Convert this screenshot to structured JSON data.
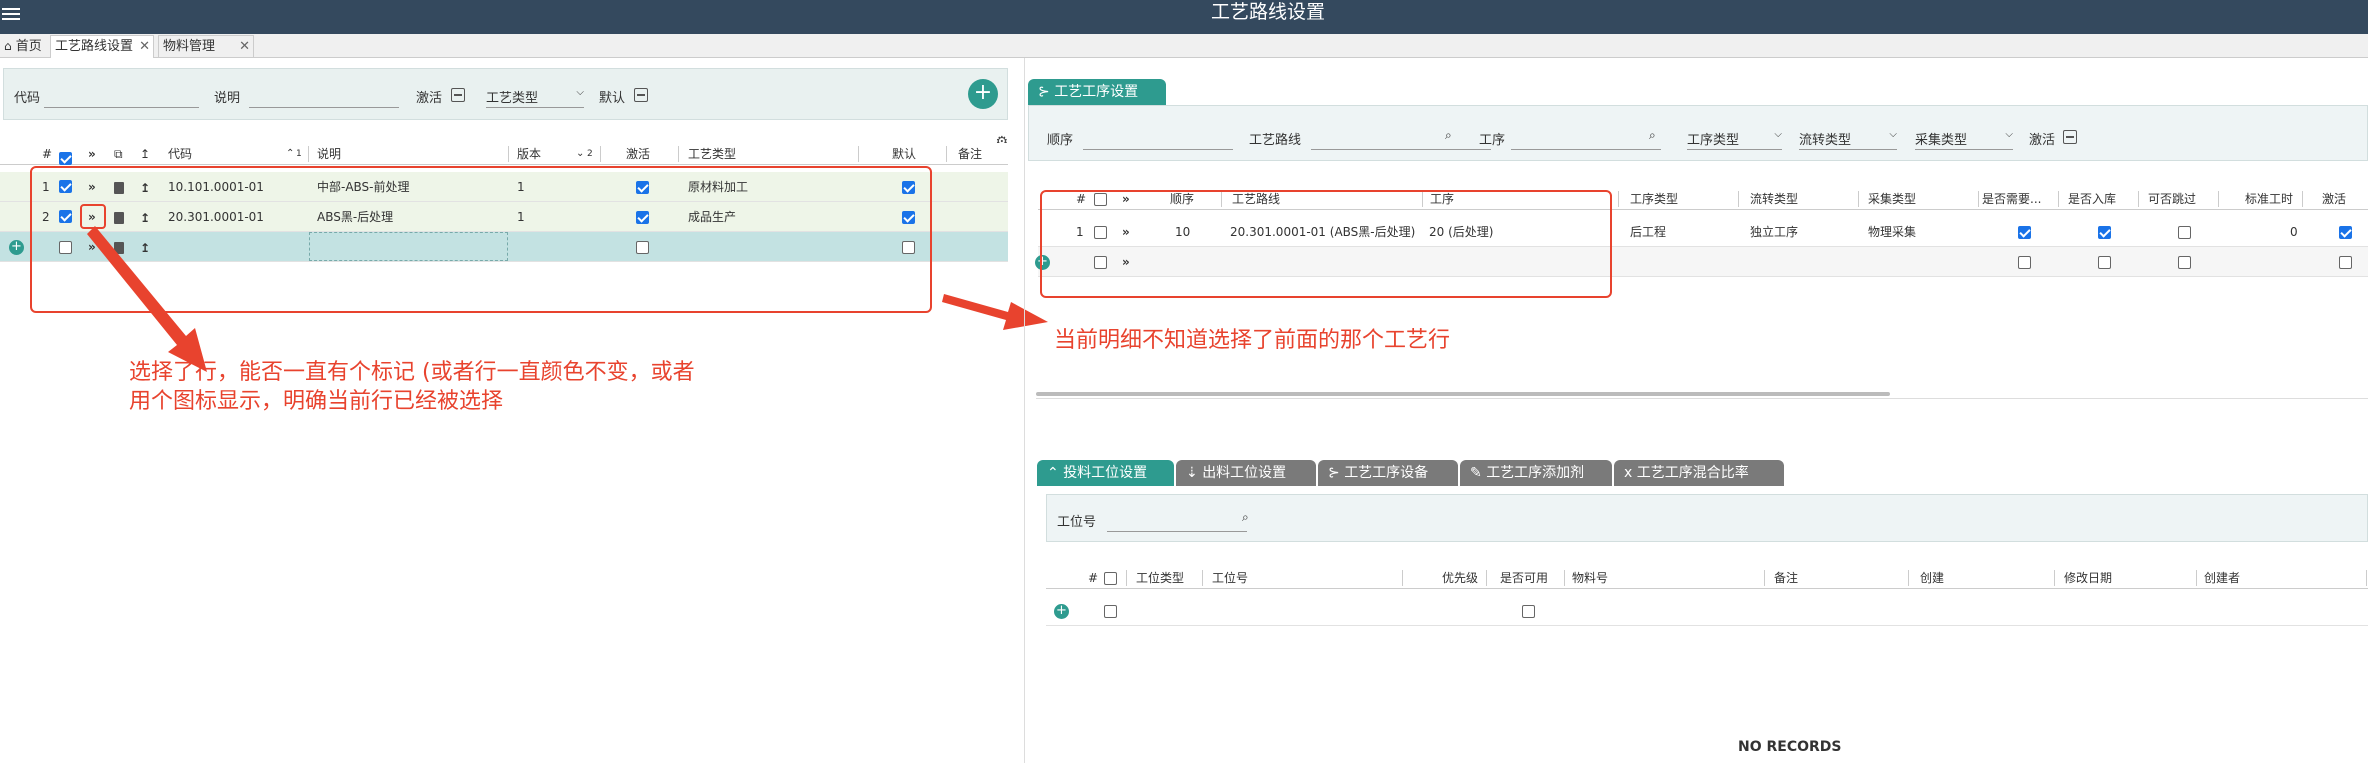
{
  "app": {
    "title": "工艺路线设置"
  },
  "tabs": [
    {
      "label": "首页"
    },
    {
      "label": "工艺路线设置"
    },
    {
      "label": "物料管理"
    }
  ],
  "left_filter": {
    "code_label": "代码",
    "desc_label": "说明",
    "active_label": "激活",
    "type_label": "工艺类型",
    "default_label": "默认"
  },
  "left_grid": {
    "headers": {
      "hash": "#",
      "code": "代码",
      "code_sort": "1",
      "desc": "说明",
      "version": "版本",
      "version_sort": "2",
      "active": "激活",
      "type": "工艺类型",
      "default": "默认",
      "remark": "备注"
    },
    "rows": [
      {
        "num": "1",
        "code": "10.101.0001-01",
        "desc": "中部-ABS-前处理",
        "version": "1",
        "type": "原材料加工"
      },
      {
        "num": "2",
        "code": "20.301.0001-01",
        "desc": "ABS黑-后处理",
        "version": "1",
        "type": "成品生产"
      }
    ]
  },
  "annotations": {
    "left_line1": "选择了行，能否一直有个标记 (或者行一直颜色不变，或者",
    "left_line2": "用个图标显示，明确当前行已经被选择",
    "right": "当前明细不知道选择了前面的那个工艺行"
  },
  "right_top": {
    "tab": "工艺工序设置",
    "filter": {
      "seq_label": "顺序",
      "route_label": "工艺路线",
      "proc_label": "工序",
      "proc_type": "工序类型",
      "flow_type": "流转类型",
      "collect_type": "采集类型",
      "active_label": "激活"
    },
    "headers": {
      "hash": "#",
      "seq": "顺序",
      "route": "工艺路线",
      "proc": "工序",
      "proc_type": "工序类型",
      "flow_type": "流转类型",
      "collect_type": "采集类型",
      "need": "是否需要...",
      "instock": "是否入库",
      "skip": "可否跳过",
      "std_time": "标准工时",
      "active": "激活"
    },
    "rows": [
      {
        "num": "1",
        "seq": "10",
        "route": "20.301.0001-01 (ABS黑-后处理)",
        "proc": "20 (后处理)",
        "proc_type": "后工程",
        "flow_type": "独立工序",
        "collect_type": "物理采集",
        "std_time": "0"
      }
    ]
  },
  "right_bottom": {
    "tabs": [
      "投料工位设置",
      "出料工位设置",
      "工艺工序设备",
      "工艺工序添加剂",
      "工艺工序混合比率"
    ],
    "filter": {
      "station_label": "工位号"
    },
    "headers": {
      "hash": "#",
      "station_type": "工位类型",
      "station_no": "工位号",
      "priority": "优先级",
      "available": "是否可用",
      "material": "物料号",
      "remark": "备注",
      "created": "创建",
      "modified": "修改日期",
      "creator": "创建者"
    },
    "empty": "NO RECORDS"
  }
}
